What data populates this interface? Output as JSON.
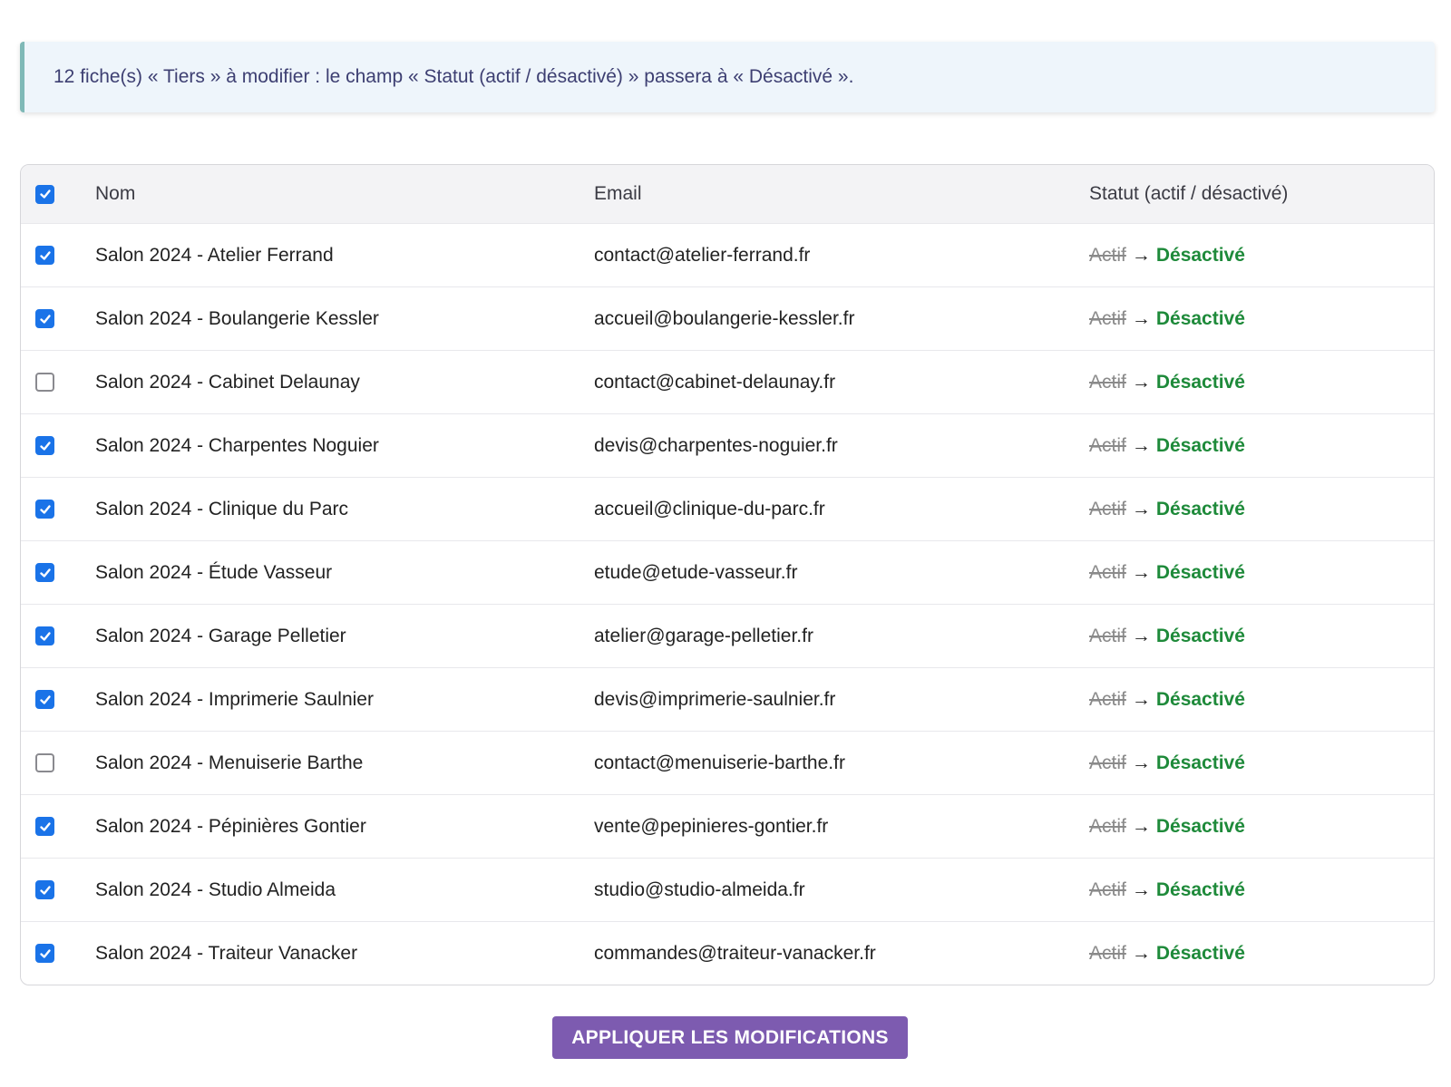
{
  "notice": {
    "text": "12 fiche(s) « Tiers » à modifier : le champ « Statut (actif / désactivé) » passera à « Désactivé »."
  },
  "table": {
    "header": {
      "all_checked": true,
      "name": "Nom",
      "email": "Email",
      "status": "Statut (actif / désactivé)"
    },
    "rows": [
      {
        "checked": true,
        "name": "Salon 2024 - Atelier Ferrand",
        "email": "contact@atelier-ferrand.fr",
        "old": "Actif",
        "arrow": "→",
        "new": "Désactivé"
      },
      {
        "checked": true,
        "name": "Salon 2024 - Boulangerie Kessler",
        "email": "accueil@boulangerie-kessler.fr",
        "old": "Actif",
        "arrow": "→",
        "new": "Désactivé"
      },
      {
        "checked": false,
        "name": "Salon 2024 - Cabinet Delaunay",
        "email": "contact@cabinet-delaunay.fr",
        "old": "Actif",
        "arrow": "→",
        "new": "Désactivé"
      },
      {
        "checked": true,
        "name": "Salon 2024 - Charpentes Noguier",
        "email": "devis@charpentes-noguier.fr",
        "old": "Actif",
        "arrow": "→",
        "new": "Désactivé"
      },
      {
        "checked": true,
        "name": "Salon 2024 - Clinique du Parc",
        "email": "accueil@clinique-du-parc.fr",
        "old": "Actif",
        "arrow": "→",
        "new": "Désactivé"
      },
      {
        "checked": true,
        "name": "Salon 2024 - Étude Vasseur",
        "email": "etude@etude-vasseur.fr",
        "old": "Actif",
        "arrow": "→",
        "new": "Désactivé"
      },
      {
        "checked": true,
        "name": "Salon 2024 - Garage Pelletier",
        "email": "atelier@garage-pelletier.fr",
        "old": "Actif",
        "arrow": "→",
        "new": "Désactivé"
      },
      {
        "checked": true,
        "name": "Salon 2024 - Imprimerie Saulnier",
        "email": "devis@imprimerie-saulnier.fr",
        "old": "Actif",
        "arrow": "→",
        "new": "Désactivé"
      },
      {
        "checked": false,
        "name": "Salon 2024 - Menuiserie Barthe",
        "email": "contact@menuiserie-barthe.fr",
        "old": "Actif",
        "arrow": "→",
        "new": "Désactivé"
      },
      {
        "checked": true,
        "name": "Salon 2024 - Pépinières Gontier",
        "email": "vente@pepinieres-gontier.fr",
        "old": "Actif",
        "arrow": "→",
        "new": "Désactivé"
      },
      {
        "checked": true,
        "name": "Salon 2024 - Studio Almeida",
        "email": "studio@studio-almeida.fr",
        "old": "Actif",
        "arrow": "→",
        "new": "Désactivé"
      },
      {
        "checked": true,
        "name": "Salon 2024 - Traiteur Vanacker",
        "email": "commandes@traiteur-vanacker.fr",
        "old": "Actif",
        "arrow": "→",
        "new": "Désactivé"
      }
    ]
  },
  "actions": {
    "apply_label": "APPLIQUER LES MODIFICATIONS"
  },
  "colors": {
    "accent": "#1a73e8",
    "new_value": "#1e8a3a",
    "button": "#7d5bb0",
    "notice_bg": "#eef5fb",
    "notice_border": "#7fb9b7"
  }
}
